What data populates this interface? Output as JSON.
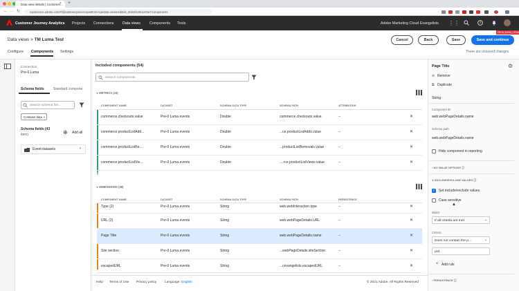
{
  "browser": {
    "tab_title": "Data view details | Customer...",
    "tab_close": "×",
    "new_tab": "+",
    "url": "experience.adobe.com/#/@adobeexperienceplatform/cja/data-views/edit/dv_60d4f2c5b1e93a7/components"
  },
  "header": {
    "app_name": "Customer Journey Analytics",
    "nav": [
      "Projects",
      "Connections",
      "Data views",
      "Components",
      "Tools"
    ],
    "org": "Adobe Marketing Cloud Evangelists",
    "prod_badge": "PROD (DATA) | STAGE UI"
  },
  "page": {
    "breadcrumb_root": "Data views",
    "breadcrumb_sep": ">",
    "title": "TM Luma Test",
    "tabs": [
      "Configure",
      "Components",
      "Settings"
    ],
    "buttons": {
      "cancel": "Cancel",
      "back": "Back",
      "save": "Save",
      "save_continue": "Save and continue"
    },
    "unsaved": "There are unsaved changes"
  },
  "left": {
    "connection_label": "Connection",
    "connection_value": "Pre-0 Luma",
    "tabs": [
      "Schema fields",
      "Standard compone"
    ],
    "search_placeholder": "Search schema fiel...",
    "chip": "Contains data ×",
    "schema_fields_label": "Schema fields (43",
    "schema_fields_label2": "item)",
    "add_all": "Add all",
    "dataset": "Event datasets"
  },
  "center": {
    "title": "Included components (54)",
    "search_placeholder": "Search components",
    "metrics_label": "METRICS (16)",
    "dimensions_label": "DIMENSIONS (38)",
    "metric_cols": [
      "COMPONENT NAME",
      "DATASET",
      "SCHEMA DATA TYPE",
      "SCHEMA PATH",
      "ATTRIBUTION"
    ],
    "dim_cols": [
      "COMPONENT NAME",
      "DATASET",
      "SCHEMA DATA TYPE",
      "SCHEMA PATH",
      "PERSISTENCE"
    ],
    "metrics": [
      {
        "name": "commerce.checkouts.value",
        "dataset": "Pre-0 Luma events",
        "type": "Double",
        "path": "commerce.checkouts.value",
        "attr": "--"
      },
      {
        "name": "commerce.productListAdd...",
        "dataset": "Pre-0 Luma events",
        "type": "Double",
        "path": "...ce.productListAdds.value",
        "attr": "--"
      },
      {
        "name": "commerce.productListRe...",
        "dataset": "Pre-0 Luma events",
        "type": "Double",
        "path": "...productListRemovals.value",
        "attr": "--"
      },
      {
        "name": "commerce.productListVie...",
        "dataset": "Pre-0 Luma events",
        "type": "Double",
        "path": "....rce.productListViews.value",
        "attr": "--"
      }
    ],
    "dimensions": [
      {
        "name": "Type (2)",
        "dataset": "Pre-0 Luma events",
        "type": "String",
        "path": "web.webInteraction.type",
        "pers": "--"
      },
      {
        "name": "URL (2)",
        "dataset": "Pre-0 Luma events",
        "type": "String",
        "path": "web.webPageDetails.URL",
        "pers": "--"
      },
      {
        "name": "Page Title",
        "dataset": "Pre-0 Luma events",
        "type": "String",
        "path": "web.webPageDetails.name",
        "pers": "--"
      },
      {
        "name": "Site section",
        "dataset": "Pre-0 Luma events",
        "type": "String",
        "path": "...webPageDetails.siteSection",
        "pers": "--"
      },
      {
        "name": "escapedURL",
        "dataset": "Pre-0 Luma events",
        "type": "String",
        "path": "...cevangelists.escapedURL",
        "pers": "--"
      }
    ],
    "remove_glyph": "✕"
  },
  "footer": {
    "links": [
      "Help",
      "Terms of Use",
      "Privacy policy"
    ],
    "language_label": "Language:",
    "language": "English",
    "copyright": "© 2021 Adobe. All Rights Reserved"
  },
  "right": {
    "title": "Page Title",
    "remove": "Remove",
    "duplicate": "Duplicate",
    "type": "String",
    "component_id_label": "Component ID",
    "component_id": "web.webPageDetails.name",
    "schema_path_label": "Schema path",
    "schema_path": "web.webPageDetails.name",
    "hide_label": "Hide component in reporting",
    "no_value_options": "NO VALUE OPTIONS",
    "include_exclude": "INCLUDE/EXCLUDE VALUES",
    "set_include_exclude": "Set include/exclude values",
    "case_sensitive": "Case sensitive",
    "match_label": "Match",
    "match_value": "If all criteria are met",
    "criteria_label": "Criteria",
    "criteria_value": "Does not contain the p...",
    "criteria_input": "prd",
    "add_rule": "Add rule",
    "persistence": "PERSISTENCE"
  },
  "colors": {
    "header_bg": "#2c2c2c",
    "accent": "#1473e6",
    "metrics_bar": "#2d9d78",
    "dimensions_bar": "#e68619",
    "selected_row": "#dceaff",
    "prod_badge": "#d7373f"
  }
}
